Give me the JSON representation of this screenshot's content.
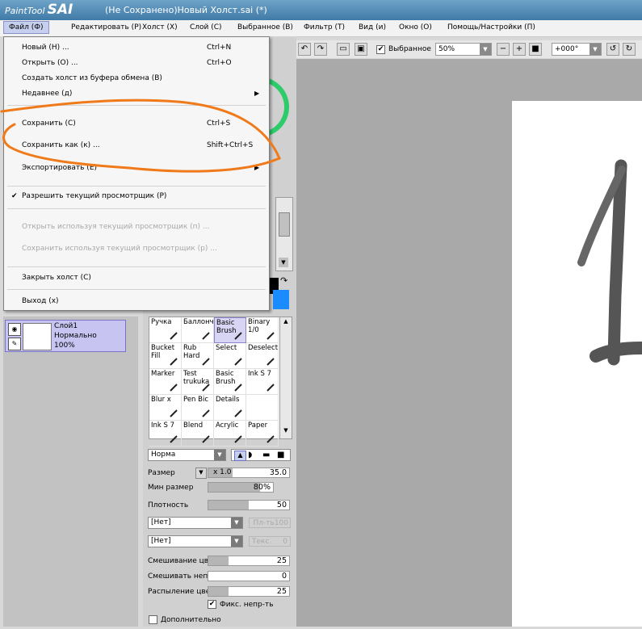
{
  "app": {
    "logo_text": "PaintTool",
    "logo_brand": "SAI",
    "window_title": "(Не Сохранено)Новый Холст.sai (*)"
  },
  "menubar": [
    {
      "label": "Файл (Ф)"
    },
    {
      "label": "Редактировать (Р)"
    },
    {
      "label": "Холст (Х)"
    },
    {
      "label": "Слой (С)"
    },
    {
      "label": "Выбранное (В)"
    },
    {
      "label": "Фильтр (Т)"
    },
    {
      "label": "Вид (и)"
    },
    {
      "label": "Окно (О)"
    },
    {
      "label": "Помощь/Настройки (П)"
    }
  ],
  "file_menu": {
    "items": [
      {
        "label": "Новый (Н) ...",
        "shortcut": "Ctrl+N"
      },
      {
        "label": "Открыть (О) ...",
        "shortcut": "Ctrl+O"
      },
      {
        "label": "Создать холст из буфера обмена (В)",
        "shortcut": ""
      },
      {
        "label": "Недавнее (д)",
        "shortcut": ""
      },
      {
        "label": "Сохранить (С)",
        "shortcut": "Ctrl+S"
      },
      {
        "label": "Сохранить как (к) ...",
        "shortcut": "Shift+Ctrl+S"
      },
      {
        "label": "Экспортировать (Е)",
        "shortcut": ""
      },
      {
        "label": "Разрешить текущий просмотрщик (Р)",
        "shortcut": ""
      },
      {
        "label": "Открыть используя текущий просмотрщик (п) ...",
        "shortcut": ""
      },
      {
        "label": "Сохранить используя текущий просмотрщик (р) ...",
        "shortcut": ""
      },
      {
        "label": "Закрыть холст (С)",
        "shortcut": ""
      },
      {
        "label": "Выход (х)",
        "shortcut": ""
      }
    ],
    "check_mark": "✔",
    "submenu_arrow": "▶"
  },
  "canvas_toolbar": {
    "selection_label": "Выбранное",
    "selection_checked": true,
    "zoom_value": "50%",
    "rotation_value": "+000°"
  },
  "layer": {
    "name": "Слой1",
    "blend": "Нормально",
    "opacity": "100%"
  },
  "tools": [
    {
      "label": "Ручка"
    },
    {
      "label": "Баллончик"
    },
    {
      "label": "Basic Brush"
    },
    {
      "label": "Binary 1/0"
    },
    {
      "label": "Bucket Fill"
    },
    {
      "label": "Rub Hard"
    },
    {
      "label": "Select"
    },
    {
      "label": "Deselect"
    },
    {
      "label": "Marker"
    },
    {
      "label": "Test trukuka"
    },
    {
      "label": "Basic Brush"
    },
    {
      "label": "Ink S 7"
    },
    {
      "label": "Blur x"
    },
    {
      "label": "Pen Bic"
    },
    {
      "label": "Details"
    },
    {
      "label": ""
    },
    {
      "label": "Ink S 7"
    },
    {
      "label": "Blend"
    },
    {
      "label": "Acrylic"
    },
    {
      "label": "Paper"
    }
  ],
  "brush": {
    "mode": "Норма",
    "size_label": "Размер",
    "size_mult": "x 1.0",
    "size_value": "35.0",
    "min_size_label": "Мин размер",
    "min_size_value": "80%",
    "min_size_level": 0.8,
    "density_label": "Плотность",
    "density_value": "50",
    "density_level": 0.5,
    "texture1": "[Нет]",
    "texture1_strength": "Пл-ть100",
    "texture2": "[Нет]",
    "texture2_strength": "Текс.",
    "texture2_value": "0",
    "blending_label": "Смешивание цве",
    "blending_value": "25",
    "blending_level": 0.25,
    "dilution_label": "Смешивать непр",
    "dilution_value": "0",
    "dilution_level": 0,
    "persistence_label": "Распыление цвет",
    "persistence_value": "25",
    "persistence_level": 0.25,
    "keep_opacity_label": "Фикс. непр-ть",
    "keep_opacity_checked": true,
    "advanced_label": "Дополнительно",
    "advanced_checked": false
  },
  "colors": {
    "accent_menu": "#c6cfee",
    "orange_annotation": "#f07a1a",
    "primary_color": "#000000",
    "secondary_color": "#1a8cff"
  }
}
